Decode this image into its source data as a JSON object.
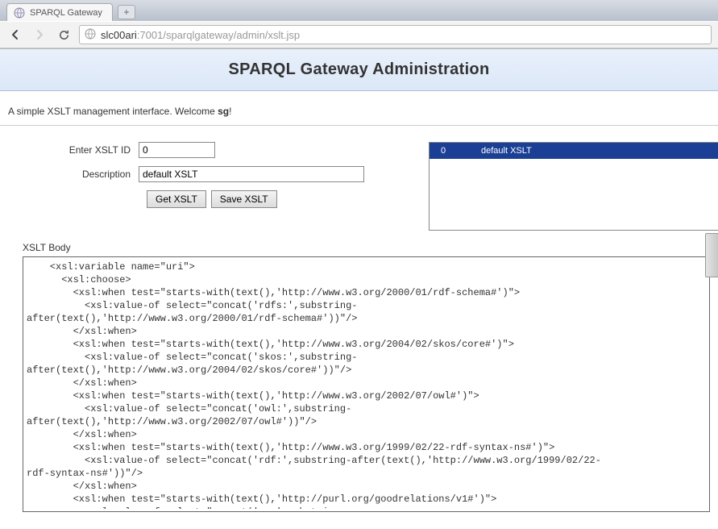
{
  "browser": {
    "tab_title": "SPARQL Gateway",
    "url_host": "slc00ari",
    "url_port": ":7001",
    "url_path": "/sparqlgateway/admin/xslt.jsp"
  },
  "header": {
    "title": "SPARQL Gateway Administration"
  },
  "welcome": {
    "prefix": "A simple XSLT management interface. Welcome ",
    "username": "sg",
    "suffix": "!"
  },
  "form": {
    "id_label": "Enter XSLT ID",
    "id_value": "0",
    "desc_label": "Description",
    "desc_value": "default XSLT",
    "get_btn": "Get XSLT",
    "save_btn": "Save XSLT"
  },
  "side_list": {
    "rows": [
      {
        "id": "0",
        "desc": "default XSLT"
      }
    ]
  },
  "body": {
    "label": "XSLT Body",
    "content": "    <xsl:variable name=\"uri\">\n      <xsl:choose>\n        <xsl:when test=\"starts-with(text(),'http://www.w3.org/2000/01/rdf-schema#')\">\n          <xsl:value-of select=\"concat('rdfs:',substring-\nafter(text(),'http://www.w3.org/2000/01/rdf-schema#'))\"/>\n        </xsl:when>\n        <xsl:when test=\"starts-with(text(),'http://www.w3.org/2004/02/skos/core#')\">\n          <xsl:value-of select=\"concat('skos:',substring-\nafter(text(),'http://www.w3.org/2004/02/skos/core#'))\"/>\n        </xsl:when>\n        <xsl:when test=\"starts-with(text(),'http://www.w3.org/2002/07/owl#')\">\n          <xsl:value-of select=\"concat('owl:',substring-\nafter(text(),'http://www.w3.org/2002/07/owl#'))\"/>\n        </xsl:when>\n        <xsl:when test=\"starts-with(text(),'http://www.w3.org/1999/02/22-rdf-syntax-ns#')\">\n          <xsl:value-of select=\"concat('rdf:',substring-after(text(),'http://www.w3.org/1999/02/22-\nrdf-syntax-ns#'))\"/>\n        </xsl:when>\n        <xsl:when test=\"starts-with(text(),'http://purl.org/goodrelations/v1#')\">\n          <xsl:value-of select=\"concat('gr:',substring-"
  }
}
